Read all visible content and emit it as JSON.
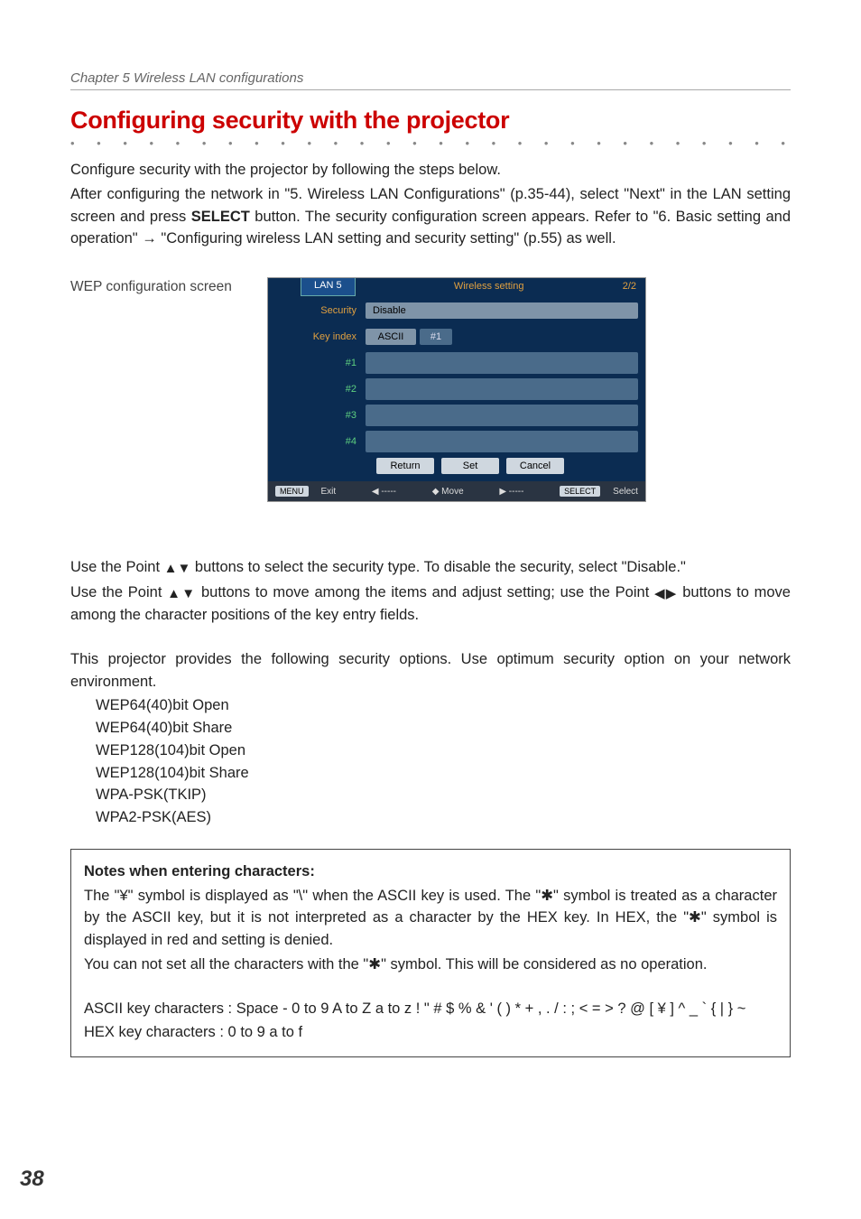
{
  "chapter": "Chapter 5 Wireless LAN configurations",
  "heading": "Configuring security with the projector",
  "intro": {
    "l1": "Configure security with the projector by following the steps below.",
    "l2a": "After configuring the network in \"5. Wireless LAN Configurations\" (p.35-44), select \"Next\" in the LAN setting screen and press ",
    "select_btn": "SELECT",
    "l2b": " button. The security configuration screen appears. Refer to \"6. Basic setting and operation\" ",
    "arrow": "→",
    "l2c": " \"Configuring wireless LAN setting and security setting\" (p.55) as well."
  },
  "wep_label": "WEP configuration screen",
  "screenshot": {
    "tab": "LAN 5",
    "title": "Wireless setting",
    "page": "2/2",
    "rows": {
      "security_lbl": "Security",
      "security_val": "Disable",
      "keyindex_lbl": "Key index",
      "ascii": "ASCII",
      "hash1": "#1",
      "r1": "#1",
      "r2": "#2",
      "r3": "#3",
      "r4": "#4"
    },
    "btns": {
      "return": "Return",
      "set": "Set",
      "cancel": "Cancel"
    },
    "footer": {
      "menu": "MENU",
      "exit": "Exit",
      "move": "Move",
      "select_chip": "SELECT",
      "select": "Select"
    }
  },
  "usage": {
    "l1a": "Use the Point ",
    "l1b": " buttons to select the security type. To disable the security, select \"Disable.\"",
    "l2a": "Use the Point ",
    "l2b": " buttons to move among the items and adjust setting; use the Point ",
    "l2c": " buttons to move among the character positions of the key entry fields.",
    "l3": "This projector provides the following security options. Use optimum security option on your network environment."
  },
  "tri": {
    "ud": "▲▼",
    "lr": "◀▶"
  },
  "security_options": [
    "WEP64(40)bit Open",
    "WEP64(40)bit Share",
    "WEP128(104)bit Open",
    "WEP128(104)bit Share",
    "WPA-PSK(TKIP)",
    "WPA2-PSK(AES)"
  ],
  "notes": {
    "title": "Notes when entering characters:",
    "p1": "The \"¥\" symbol is displayed as \"\\\" when the ASCII key is used. The \"✱\" symbol is treated as a character by the ASCII key, but it is not interpreted as a character by the HEX key. In HEX, the \"✱\" symbol is displayed in red and setting is denied.",
    "p2": "You can not set all the characters with the \"✱\" symbol. This will be considered as no operation.",
    "ascii": "ASCII key characters : Space - 0 to 9 A to Z a to z ! \" # $ % & ' ( ) * + , . / : ; < = > ? @ [ ¥ ] ^ _ ` { | } ~",
    "hex": "HEX key characters : 0 to 9 a to f"
  },
  "page_number": "38"
}
